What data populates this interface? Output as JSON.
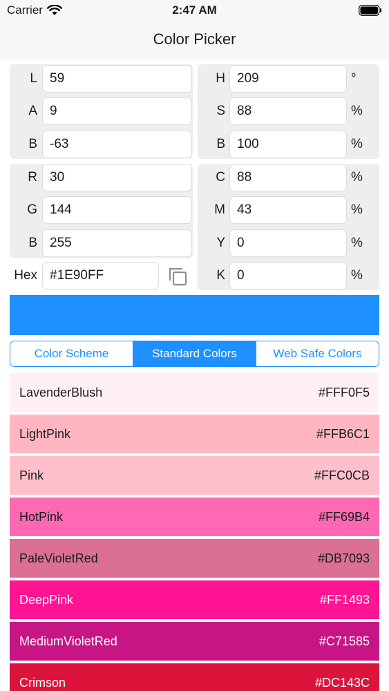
{
  "status": {
    "carrier": "Carrier",
    "time": "2:47 AM"
  },
  "nav": {
    "title": "Color Picker"
  },
  "lab": {
    "l_label": "L",
    "l": "59",
    "a_label": "A",
    "a": "9",
    "b_label": "B",
    "b": "-63"
  },
  "hsb": {
    "h_label": "H",
    "h": "209",
    "h_unit": "°",
    "s_label": "S",
    "s": "88",
    "s_unit": "%",
    "b_label": "B",
    "b": "100",
    "b_unit": "%"
  },
  "rgb": {
    "r_label": "R",
    "r": "30",
    "g_label": "G",
    "g": "144",
    "b_label": "B",
    "b": "255"
  },
  "cmyk": {
    "c_label": "C",
    "c": "88",
    "c_unit": "%",
    "m_label": "M",
    "m": "43",
    "m_unit": "%",
    "y_label": "Y",
    "y": "0",
    "y_unit": "%",
    "k_label": "K",
    "k": "0",
    "k_unit": "%"
  },
  "hex": {
    "label": "Hex",
    "value": "#1E90FF"
  },
  "swatch_color": "#1E90FF",
  "tabs": [
    {
      "label": "Color Scheme",
      "active": false
    },
    {
      "label": "Standard Colors",
      "active": true
    },
    {
      "label": "Web Safe Colors",
      "active": false
    }
  ],
  "colors": [
    {
      "name": "LavenderBlush",
      "hex": "#FFF0F5",
      "text": "#1c1c1e"
    },
    {
      "name": "LightPink",
      "hex": "#FFB6C1",
      "text": "#1c1c1e"
    },
    {
      "name": "Pink",
      "hex": "#FFC0CB",
      "text": "#1c1c1e"
    },
    {
      "name": "HotPink",
      "hex": "#FF69B4",
      "text": "#1c1c1e"
    },
    {
      "name": "PaleVioletRed",
      "hex": "#DB7093",
      "text": "#1c1c1e"
    },
    {
      "name": "DeepPink",
      "hex": "#FF1493",
      "text": "#ffffff"
    },
    {
      "name": "MediumVioletRed",
      "hex": "#C71585",
      "text": "#ffffff"
    },
    {
      "name": "Crimson",
      "hex": "#DC143C",
      "text": "#ffffff"
    }
  ]
}
